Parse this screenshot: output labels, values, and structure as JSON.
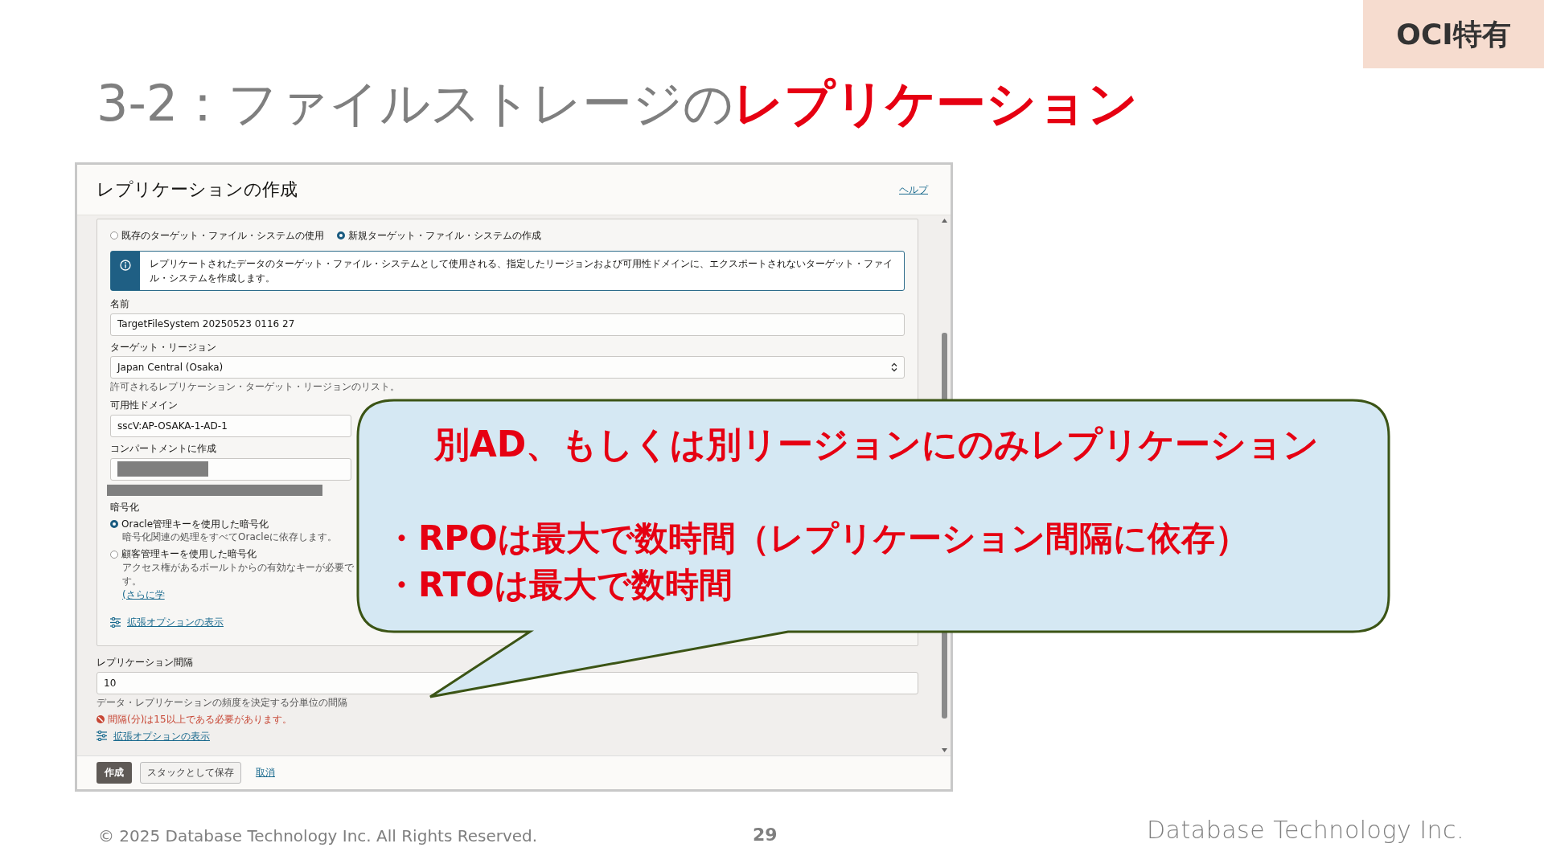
{
  "tag": "OCI特有",
  "title": "3-2：ファイルストレージの**レプリケーション**",
  "dialog": {
    "title": "レプリケーションの作成",
    "help_link": "ヘルプ",
    "target_options": [
      {
        "label": "既存のターゲット・ファイル・システムの使用",
        "selected": false
      },
      {
        "label": "新規ターゲット・ファイル・システムの作成",
        "selected": true
      }
    ],
    "info": "レプリケートされたデータのターゲット・ファイル・システムとして使用される、指定したリージョンおよび可用性ドメインに、エクスポートされないターゲット・ファイル・システムを作成します。",
    "fields": [
      {
        "kind": "text",
        "label": "名前",
        "value": "TargetFileSystem 20250523 0116 27"
      },
      {
        "kind": "select",
        "label": "ターゲット・リージョン",
        "value": "Japan Central (Osaka)",
        "hint": "許可されるレプリケーション・ターゲット・リージョンのリスト。"
      },
      {
        "kind": "text",
        "label": "可用性ドメイン",
        "value": "sscV:AP-OSAKA-1-AD-1"
      },
      {
        "kind": "redacted",
        "label": "コンパートメントに作成"
      }
    ],
    "encryption": {
      "label": "暗号化",
      "options": [
        {
          "label": "Oracle管理キーを使用した暗号化",
          "description": "暗号化関連の処理をすべてOracleに依存します。",
          "selected": true
        },
        {
          "label": "顧客管理キーを使用した暗号化",
          "description": "アクセス権があるボールトからの有効なキーが必要です。",
          "link": "(さらに学",
          "selected": false
        }
      ]
    },
    "advanced_link": "拡張オプションの表示",
    "interval": {
      "label": "レプリケーション間隔",
      "value": "10",
      "hint": "データ・レプリケーションの頻度を決定する分単位の間隔",
      "error": "間隔(分)は15以上である必要があります。"
    },
    "advanced_link_2": "拡張オプションの表示",
    "buttons": [
      {
        "label": "作成",
        "kind": "primary"
      },
      {
        "label": "スタックとして保存",
        "kind": "secondary"
      },
      {
        "label": "取消",
        "kind": "link"
      }
    ]
  },
  "callout": {
    "heading": "別AD、もしくは別リージョンにのみレプリケーション",
    "points": [
      "・RPOは最大で数時間（レプリケーション間隔に依存）",
      "・RTOは最大で数時間"
    ]
  },
  "footer": {
    "copyright": "© 2025 Database Technology Inc. All Rights Reserved.",
    "page": "29",
    "logo": "Database Technology Inc."
  }
}
